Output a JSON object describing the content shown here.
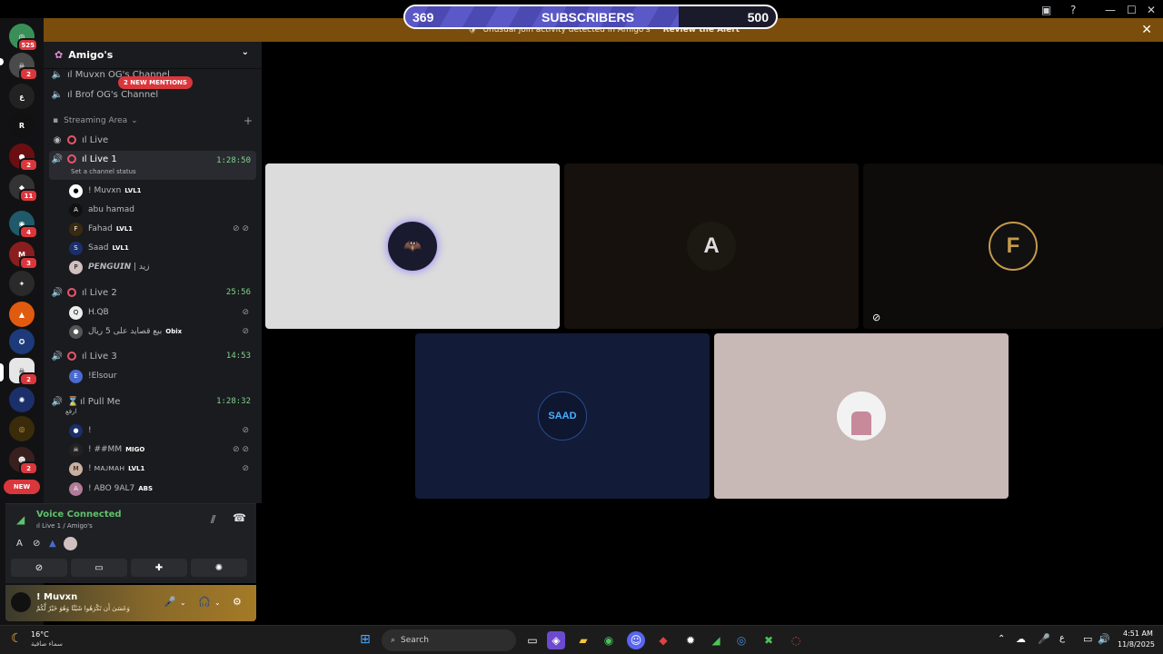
{
  "subscriber_bar": {
    "current": "369",
    "label": "SUBSCRIBERS",
    "goal": "500",
    "progress": 0.738
  },
  "alert": {
    "text": "Unusual join activity detected in Amigo's",
    "action": "Review the Alert"
  },
  "servers": [
    {
      "name": "home",
      "badge": "525"
    },
    {
      "name": "server-2",
      "badge": "2"
    },
    {
      "name": "server-3",
      "badge": ""
    },
    {
      "name": "server-4",
      "badge": ""
    },
    {
      "name": "server-5",
      "badge": "2"
    },
    {
      "name": "server-6",
      "badge": "11"
    },
    {
      "name": "server-7",
      "badge": "4"
    },
    {
      "name": "server-8",
      "badge": "3"
    },
    {
      "name": "server-9",
      "badge": ""
    },
    {
      "name": "server-10",
      "badge": ""
    },
    {
      "name": "server-11",
      "badge": ""
    },
    {
      "name": "server-12",
      "badge": "2"
    },
    {
      "name": "server-13",
      "badge": ""
    },
    {
      "name": "server-14",
      "badge": ""
    },
    {
      "name": "server-15",
      "badge": "2"
    },
    {
      "name": "new",
      "badge": "NEW"
    }
  ],
  "sidebar": {
    "server_name": "Amigo's",
    "mentions": "2 NEW MENTIONS",
    "channels_top": [
      "ıl Muvxn OG's Channel",
      "ıl Brof OG's Channel"
    ],
    "category": "Streaming Area",
    "live": "ıl Live",
    "live1": {
      "name": "ıl Live 1",
      "time": "1:28:50",
      "status": "Set a channel status"
    },
    "live1_users": [
      {
        "name": "! Muvxn",
        "tag": "LVL1"
      },
      {
        "name": "abu hamad",
        "tag": ""
      },
      {
        "name": "Fahad",
        "tag": "LVL1"
      },
      {
        "name": "Saad",
        "tag": "LVL1"
      },
      {
        "name": "𝙋𝙀𝙉𝙂𝙐𝙄𝙉 | زيد",
        "tag": ""
      }
    ],
    "live2": {
      "name": "ıl Live 2",
      "time": "25:56"
    },
    "live2_users": [
      {
        "name": "H.QB",
        "tag": ""
      },
      {
        "name": "بيع قصايد على 5 ريال",
        "tag": "Obix"
      }
    ],
    "live3": {
      "name": "ıl Live 3",
      "time": "14:53"
    },
    "live3_users": [
      {
        "name": "!Elsour",
        "tag": ""
      }
    ],
    "pullme": {
      "name": "ıl Pull Me",
      "time": "1:28:32",
      "sub": "ارفع"
    },
    "pullme_users": [
      {
        "name": "!",
        "tag": ""
      },
      {
        "name": "! ##MM",
        "tag": "MIGO"
      },
      {
        "name": "! ᴍᴀᴊᴍᴀʜ",
        "tag": "LVL1"
      },
      {
        "name": "! ABO 9AL7",
        "tag": "ABS"
      }
    ]
  },
  "voice": {
    "title": "Voice Connected",
    "channel": "ıl Live 1 / Amigo's"
  },
  "user_panel": {
    "name": "! Muvxn",
    "status": "وَعَسَىٰ أَن تَكْرَهُوا شَيْئًا وَهُوَ خَيْرٌ لَّكُمْ"
  },
  "tiles": [
    {
      "name": "batman",
      "bg": "#dcdcdc"
    },
    {
      "name": "a-logo",
      "bg": "#16110c",
      "text": "A"
    },
    {
      "name": "f-logo",
      "bg": "#0d0c0b",
      "text": "F"
    },
    {
      "name": "saad",
      "bg": "#121c38",
      "text": "SAAD"
    },
    {
      "name": "portrait",
      "bg": "#c8b8b6"
    }
  ],
  "taskbar": {
    "weather_temp": "16°C",
    "weather_desc": "سماء صافية",
    "search_placeholder": "Search",
    "time": "4:51 AM",
    "date": "11/8/2025",
    "lang": "ع"
  },
  "colors": {
    "accent_green": "#5ec26a",
    "mention_red": "#da373c",
    "alert_orange": "#7a4d0c"
  }
}
